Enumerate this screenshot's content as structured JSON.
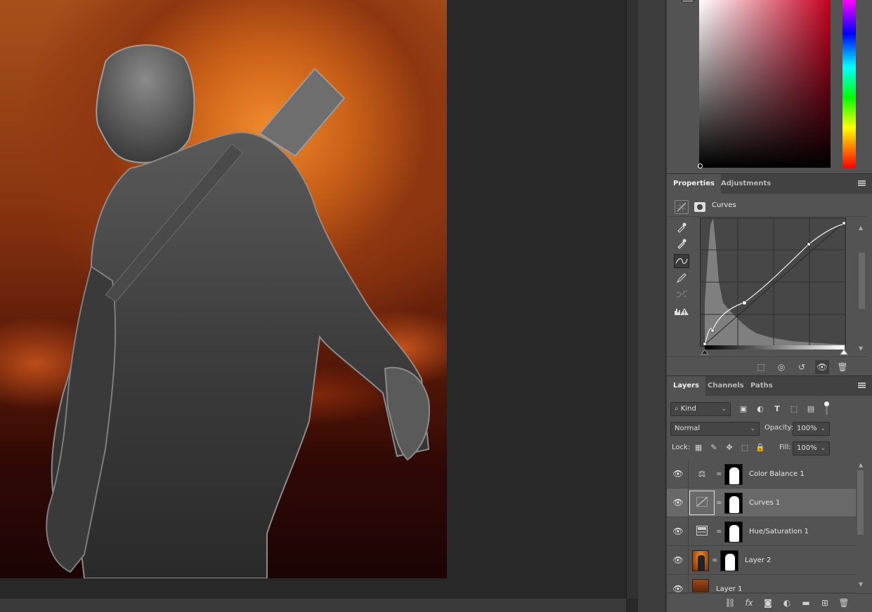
{
  "properties_panel": {
    "tabs": [
      "Properties",
      "Adjustments"
    ],
    "adjustment_name": "Curves",
    "tools": [
      "sample-in-image-eyedropper-icon",
      "sample-gray-eyedropper-icon",
      "edit-points-icon",
      "pencil-draw-icon",
      "smooth-icon",
      "auto-warning-icon"
    ]
  },
  "layers_panel": {
    "tabs": [
      "Layers",
      "Channels",
      "Paths"
    ],
    "filter_kind": "Kind",
    "blend_mode": "Normal",
    "opacity_label": "Opacity:",
    "opacity_value": "100%",
    "lock_label": "Lock:",
    "fill_label": "Fill:",
    "fill_value": "100%",
    "layers": [
      {
        "name": "Color Balance 1",
        "type": "adjustment",
        "icon": "balance-icon",
        "visible": true,
        "selected": false
      },
      {
        "name": "Curves 1",
        "type": "adjustment",
        "icon": "curves-icon",
        "visible": true,
        "selected": true
      },
      {
        "name": "Hue/Saturation 1",
        "type": "adjustment",
        "icon": "hue-saturation-icon",
        "visible": true,
        "selected": false
      },
      {
        "name": "Layer 2",
        "type": "image",
        "visible": true,
        "selected": false
      },
      {
        "name": "Layer 1",
        "type": "image",
        "visible": true,
        "selected": false
      }
    ]
  },
  "colors": {
    "panel_bg": "#535353",
    "tab_bar": "#424242",
    "workspace": "#282828",
    "selected_layer": "#696969"
  }
}
